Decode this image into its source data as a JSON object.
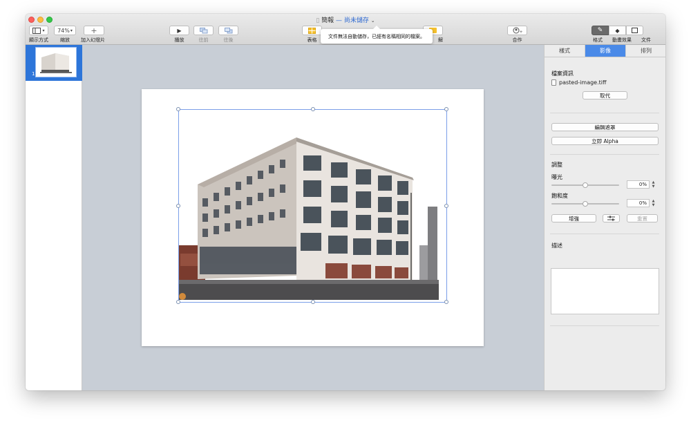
{
  "window": {
    "title": "簡報",
    "title_separator": "—",
    "status": "尚未儲存",
    "tooltip": "文件無法自動儲存，已經有名稱相同的檔案。"
  },
  "toolbar": {
    "view_label": "顯示方式",
    "zoom_value": "74%",
    "zoom_label": "縮放",
    "add_slide_label": "加入幻燈片",
    "play_label": "播放",
    "back_label": "往前",
    "forward_label": "往後",
    "table_label": "表格",
    "comment_label_partial": "解",
    "collaborate_label": "合作",
    "format_label": "格式",
    "animate_label": "動畫效果",
    "document_label": "文件"
  },
  "navigator": {
    "slide_number": "1"
  },
  "inspector": {
    "tabs": [
      "樣式",
      "影像",
      "排列"
    ],
    "active_tab": "影像",
    "file_info_title": "檔案資訊",
    "file_name": "pasted-image.tiff",
    "replace_label": "取代",
    "edit_mask_label": "編輯遮罩",
    "instant_alpha_label": "立即 Alpha",
    "adjust_title": "調整",
    "exposure_label": "曝光",
    "exposure_value": "0%",
    "exposure_level": 0.5,
    "saturation_label": "飽和度",
    "saturation_value": "0%",
    "saturation_level": 0.5,
    "enhance_label": "增強",
    "reset_label": "重置",
    "description_title": "描述",
    "description_value": ""
  },
  "colors": {
    "accent": "#4a8ae8",
    "selection_blue": "#2d75d9",
    "canvas_bg": "#c8ced6",
    "status_blue": "#2e69d1"
  }
}
